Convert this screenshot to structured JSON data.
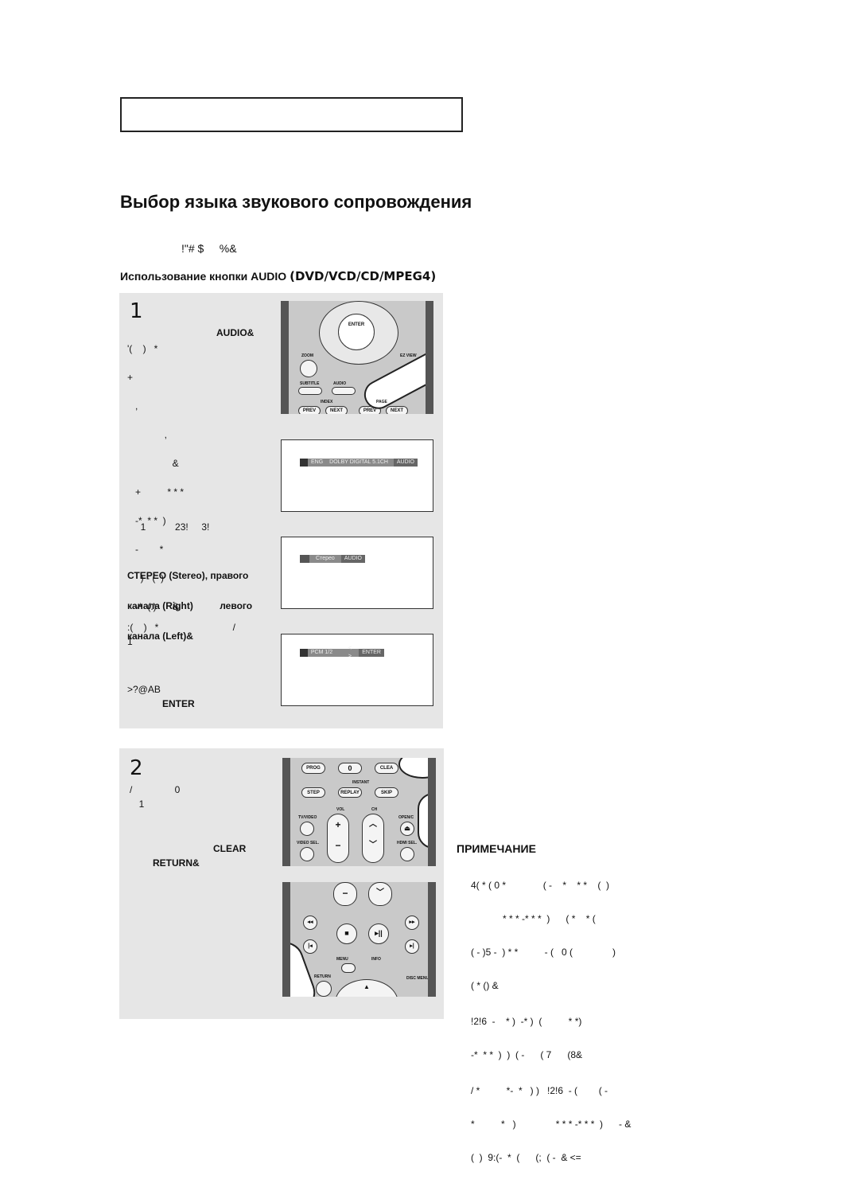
{
  "page": {
    "title": "Выбор языка звукового сопровождения",
    "intro": "!\"# $     %&",
    "subtitle": "Использование кнопки AUDIO",
    "subtitle_modes": "(DVD/VCD/CD/MPEG4)"
  },
  "step1": {
    "number": "1",
    "lines": [
      "'(    )   *",
      "+",
      "   ,",
      "              ,",
      "                 &",
      "   +          * * *",
      "   -*  * *  )",
      "   -        *",
      "     ) - (  )",
      "   -*  (.)      &"
    ],
    "audio_label": "AUDIO&",
    "line_mode": "     1           23!     3!",
    "stereo_lines": [
      "СТЕРЕО (Stereo), правого",
      "канала (Right)          левого",
      "канала (Left)&"
    ],
    "line_pcm1": ":(    )   *                            /",
    "line_pcm2": "1",
    "line_sym": ">?@AB",
    "enter_label": "ENTER",
    "osd1": {
      "lang": "ENG",
      "format": "DOLBY DIGITAL 5.1CH",
      "tag": "AUDIO"
    },
    "osd2": {
      "text": "Стерео",
      "tag": "AUDIO"
    },
    "osd3": {
      "text": "PCM 1/2",
      "arrows": "< >",
      "tag": "ENTER"
    },
    "remote": {
      "enter": "ENTER",
      "zoom": "ZOOM",
      "ezview": "EZ VIEW",
      "subtitle": "SUBTITLE",
      "audio": "AUDIO",
      "index": "INDEX",
      "page": "PAGE",
      "prev1": "PREV",
      "next1": "NEXT",
      "prev2": "PREV",
      "next2": "NEXT"
    }
  },
  "step2": {
    "number": "2",
    "line1": "/                0",
    "line2": "  1",
    "clear_label": "CLEAR",
    "return_label": "RETURN&",
    "remote": {
      "prog": "PROG",
      "zero": "0",
      "clear": "CLEA",
      "instant": "INSTANT",
      "step": "STEP",
      "replay": "REPLAY",
      "skip": "SKIP",
      "tvvideo": "TV/VIDEO",
      "vol": "VOL",
      "ch": "CH",
      "open": "OPEN/C",
      "videosel": "VIDEO SEL.",
      "hdmisel": "HDMI SEL.",
      "menu": "MENU",
      "info": "INFO",
      "return": "RETURN",
      "discmenu": "DISC MENU"
    }
  },
  "note": {
    "title": "ПРИМЕЧАНИЕ",
    "lines": [
      "4( * ( 0 *              ( -    *    * *    (  )",
      "            * * * -* * *  )      ( *    * (",
      "( - )5 -  ) * *          - (   0 (               )",
      "( * () &",
      "!2!6  -    * )  -* )  (          * *)",
      "-*  * *  )  )  ( -      ( 7      (8&",
      "/ *          *-  *   ) )   !2!6  - (        ( -",
      "*          *   )               * * * -* * *  )      - &",
      "(  )  9:(-  *  (      (;  ( -  & <="
    ]
  }
}
